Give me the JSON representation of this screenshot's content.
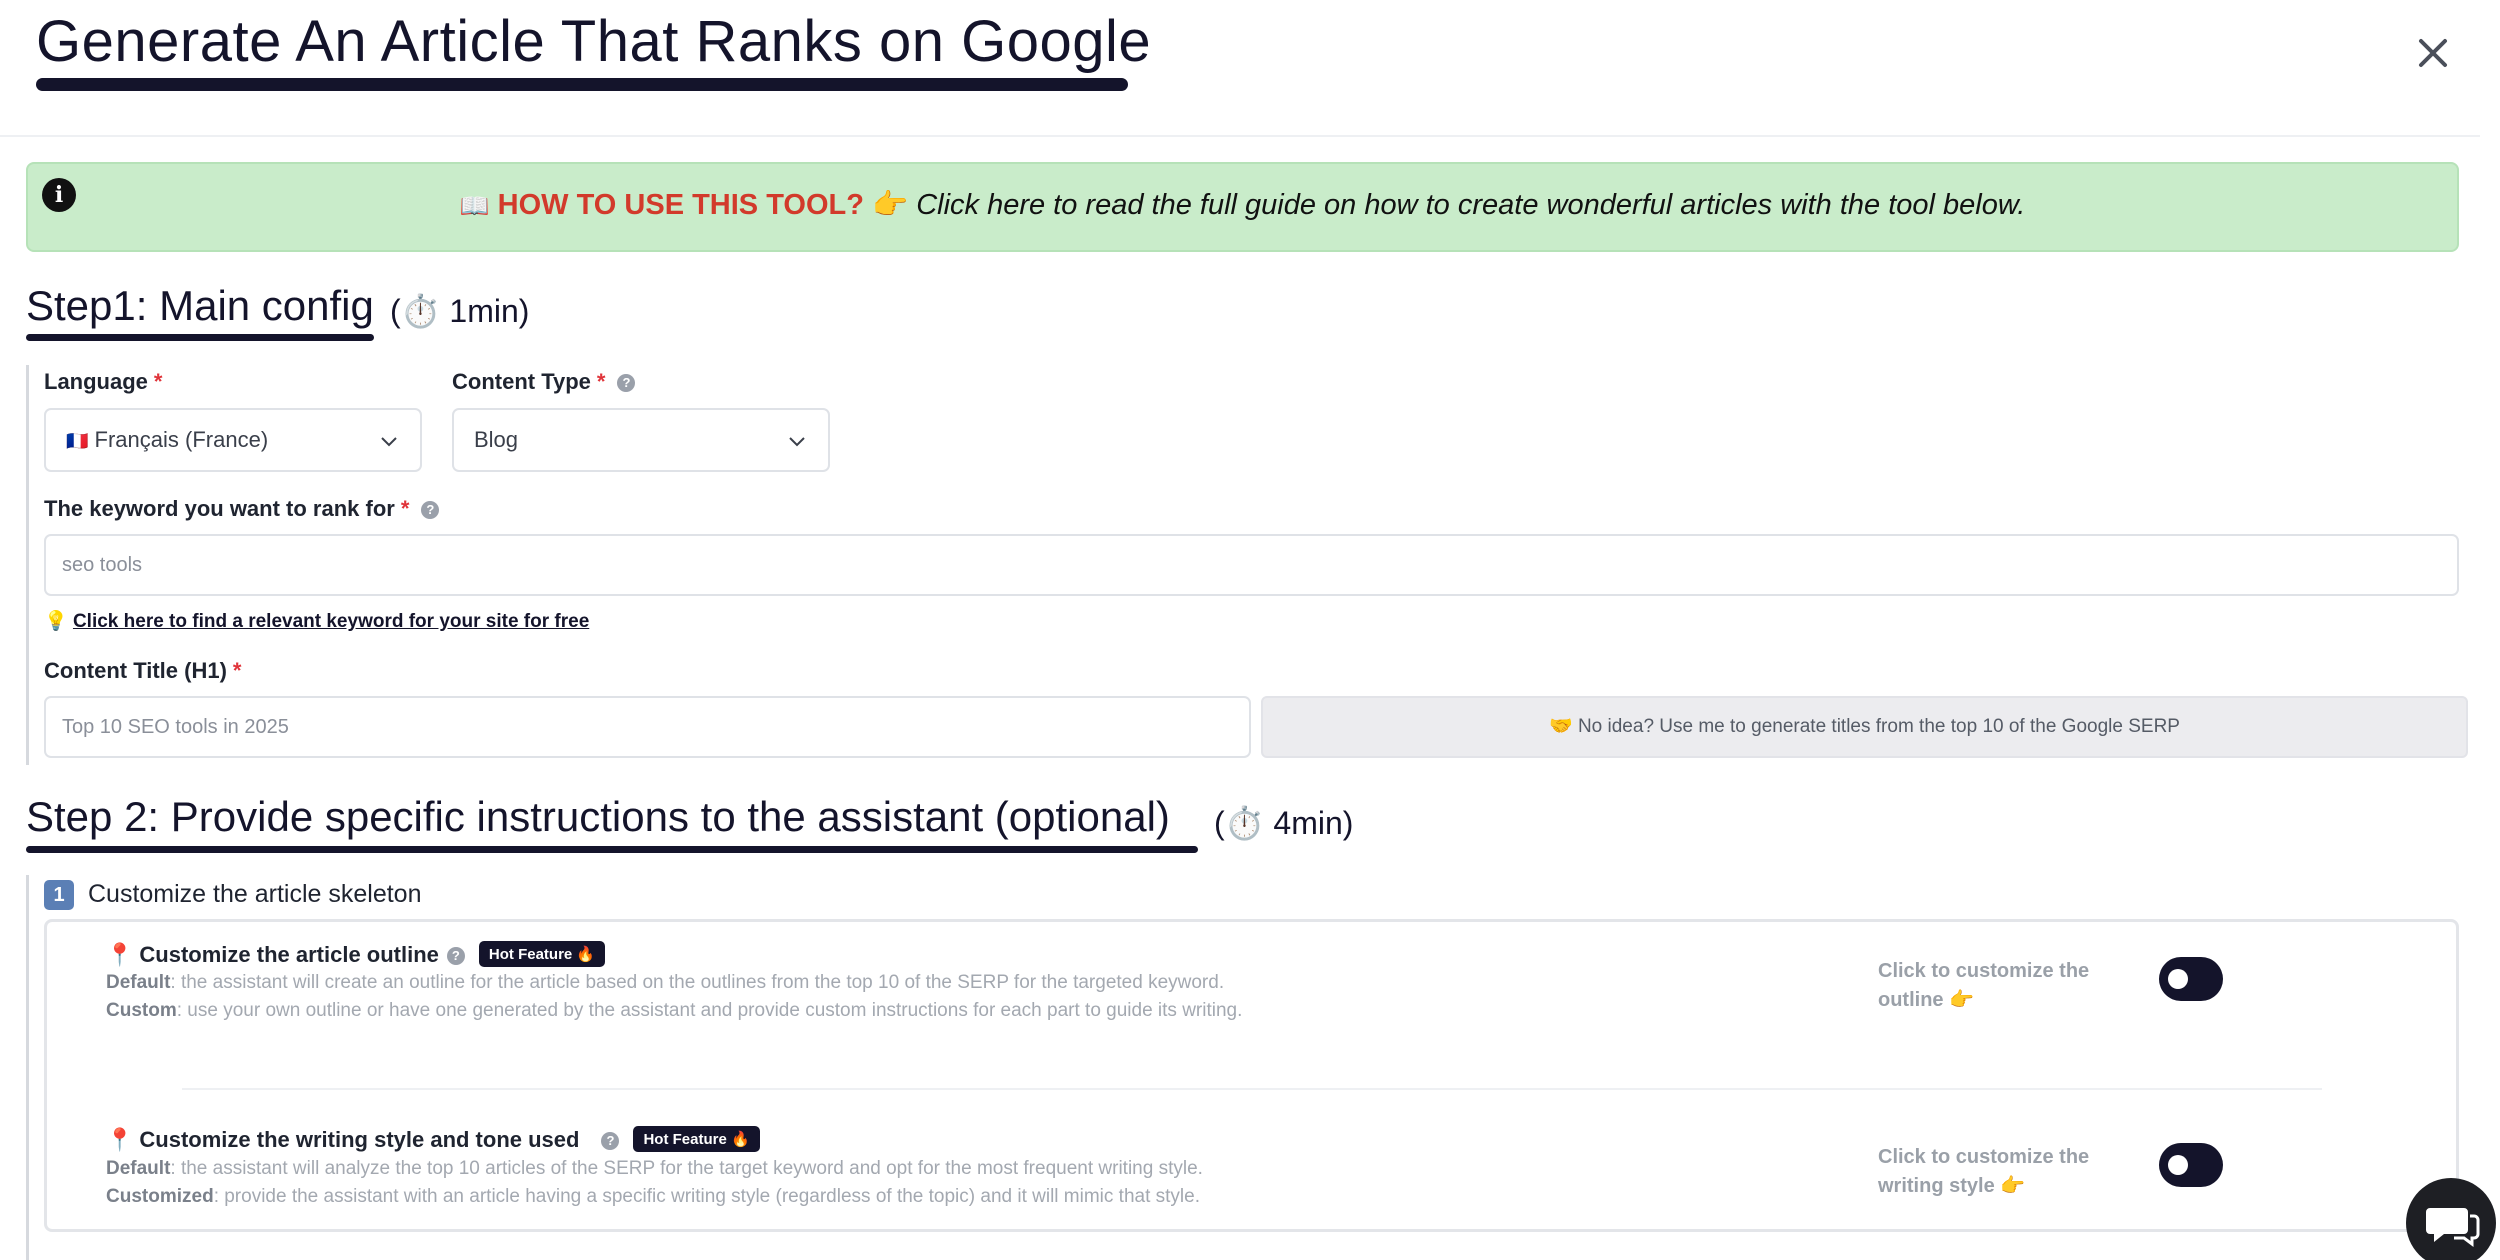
{
  "header": {
    "title": "Generate An Article That Ranks on Google",
    "close_label": "×"
  },
  "banner": {
    "book_emoji": "📖",
    "howto": "HOW TO USE THIS TOOL?",
    "point_emoji": "👉",
    "guide": "Click here to read the full guide on how to create wonderful articles with the tool below."
  },
  "step1": {
    "title": "Step1: Main config",
    "time": "(⏱️ 1min)",
    "language": {
      "label": "Language",
      "required": "*",
      "flag": "🇫🇷",
      "value": "Français (France)"
    },
    "content_type": {
      "label": "Content Type",
      "required": "*",
      "help": "?",
      "value": "Blog"
    },
    "keyword": {
      "label": "The keyword you want to rank for",
      "required": "*",
      "help": "?",
      "placeholder": "seo tools"
    },
    "keyword_link": {
      "emoji": "💡",
      "text": "Click here to find a relevant keyword for your site for free"
    },
    "content_title": {
      "label": "Content Title (H1)",
      "required": "*",
      "placeholder": "Top 10 SEO tools in 2025"
    },
    "generate_button": "🤝 No idea? Use me to generate titles from the top 10 of the Google SERP"
  },
  "step2": {
    "title": "Step 2: Provide specific instructions to the assistant (optional)",
    "time": "(⏱️ 4min)",
    "section_number": "1",
    "section_label": "Customize the article skeleton",
    "features": [
      {
        "pin": "📍",
        "title": "Customize the article outline",
        "help": "?",
        "badge": "Hot Feature 🔥",
        "default_label": "Default",
        "default_text": ": the assistant will create an outline for the article based on the outlines from the top 10 of the SERP for the targeted keyword.",
        "custom_label": "Custom",
        "custom_text": ": use your own outline or have one generated by the assistant and provide custom instructions for each part to guide its writing.",
        "toggle_text": "Click to customize the outline 👉"
      },
      {
        "pin": "📍",
        "title": "Customize the writing style and tone used",
        "help": "?",
        "badge": "Hot Feature 🔥",
        "default_label": "Default",
        "default_text": ": the assistant will analyze the top 10 articles of the SERP for the target keyword and opt for the most frequent writing style.",
        "custom_label": "Customized",
        "custom_text": ": provide the assistant with an article having a specific writing style (regardless of the topic) and it will mimic that style.",
        "toggle_text": "Click to customize the writing style 👉"
      }
    ]
  },
  "colors": {
    "primary": "#14142b",
    "banner_bg": "#c9ecca",
    "howto_red": "#d23a2b",
    "required_red": "#e0343a"
  }
}
